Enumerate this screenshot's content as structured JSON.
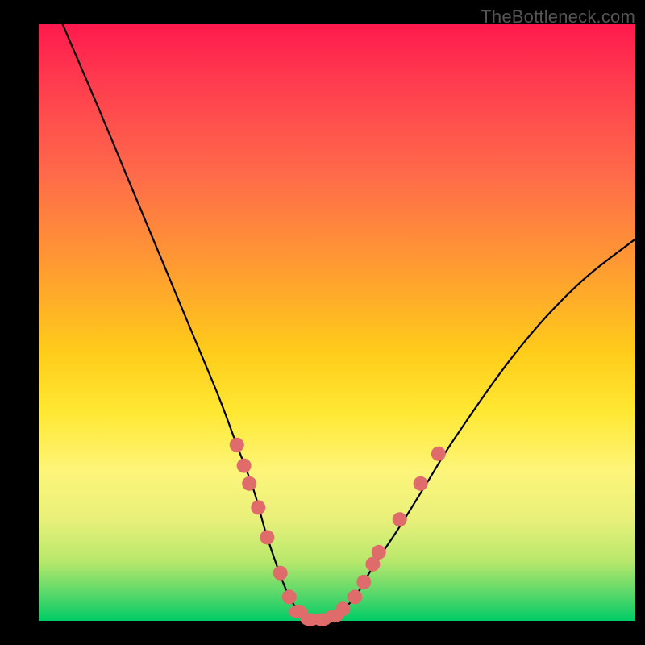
{
  "watermark": "TheBottleneck.com",
  "colors": {
    "frame": "#000000",
    "marker": "#e06b6b",
    "curve": "#000000",
    "gradient_top": "#ff1a4d",
    "gradient_bottom": "#00cc66"
  },
  "chart_data": {
    "type": "line",
    "title": "",
    "xlabel": "",
    "ylabel": "",
    "xlim": [
      0,
      100
    ],
    "ylim": [
      0,
      100
    ],
    "curve": {
      "name": "bottleneck-curve",
      "x": [
        4,
        10,
        15,
        20,
        25,
        30,
        33,
        36,
        38,
        40,
        42,
        44,
        45,
        46,
        48,
        50,
        53,
        56,
        60,
        65,
        70,
        80,
        90,
        100
      ],
      "y": [
        100,
        86,
        74,
        62,
        50,
        38,
        30,
        22,
        15,
        9,
        4,
        1,
        0,
        0,
        0,
        1,
        4,
        9,
        15,
        23,
        31,
        45,
        56,
        64
      ]
    },
    "markers": [
      {
        "x": 33.2,
        "y": 29.5
      },
      {
        "x": 34.4,
        "y": 26.0
      },
      {
        "x": 35.3,
        "y": 23.0
      },
      {
        "x": 36.8,
        "y": 19.0
      },
      {
        "x": 38.3,
        "y": 14.0
      },
      {
        "x": 40.5,
        "y": 8.0
      },
      {
        "x": 42.0,
        "y": 4.0
      },
      {
        "x": 43.5,
        "y": 1.5,
        "shape": "oval"
      },
      {
        "x": 45.5,
        "y": 0.2,
        "shape": "oval"
      },
      {
        "x": 47.5,
        "y": 0.2,
        "shape": "oval"
      },
      {
        "x": 49.5,
        "y": 0.8,
        "shape": "oval"
      },
      {
        "x": 51.0,
        "y": 2.0
      },
      {
        "x": 53.0,
        "y": 4.0
      },
      {
        "x": 54.5,
        "y": 6.5
      },
      {
        "x": 56.0,
        "y": 9.5
      },
      {
        "x": 57.0,
        "y": 11.5
      },
      {
        "x": 60.5,
        "y": 17.0
      },
      {
        "x": 64.0,
        "y": 23.0
      },
      {
        "x": 67.0,
        "y": 28.0
      }
    ]
  }
}
